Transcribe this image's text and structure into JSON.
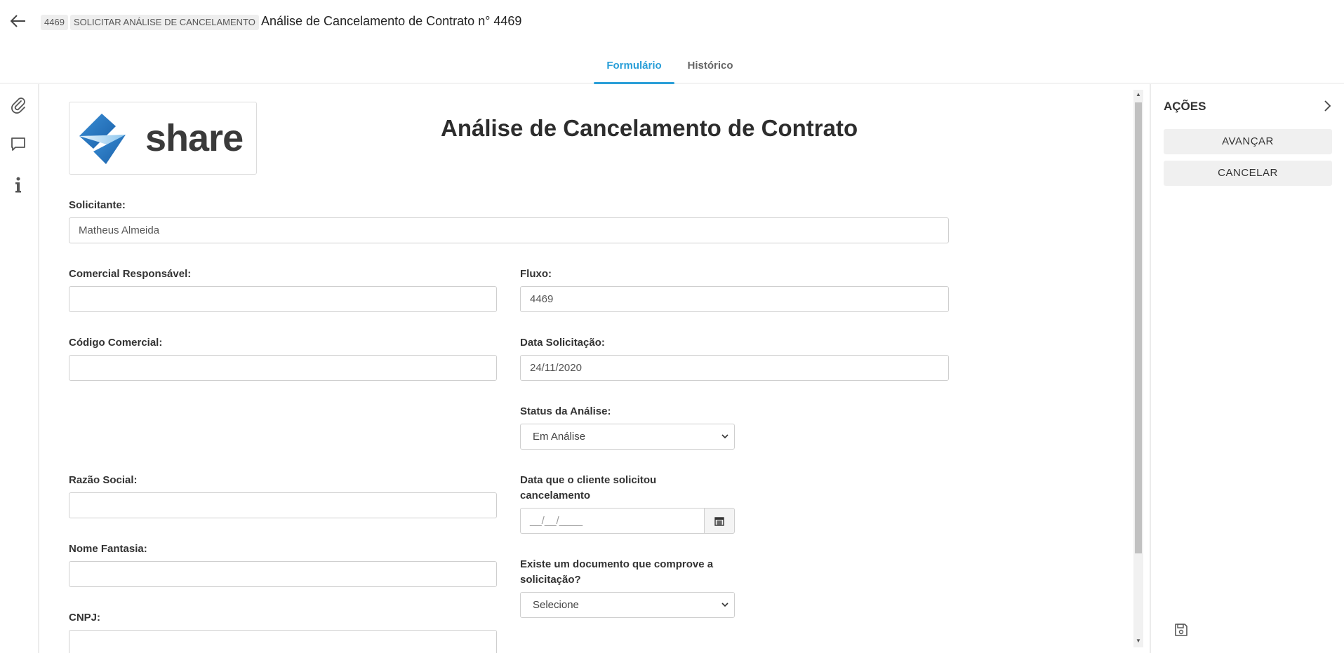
{
  "header": {
    "id_chip": "4469",
    "step_chip": "SOLICITAR ANÁLISE DE CANCELAMENTO",
    "title": "Análise de Cancelamento de Contrato n° 4469"
  },
  "tabs": [
    {
      "label": "Formulário",
      "active": true
    },
    {
      "label": "Histórico",
      "active": false
    }
  ],
  "rail": {
    "icons": [
      "paperclip-icon",
      "comment-icon",
      "info-icon"
    ]
  },
  "form": {
    "logo_text": "share",
    "heading": "Análise de Cancelamento de Contrato",
    "solicitante": {
      "label": "Solicitante:",
      "value": "Matheus Almeida"
    },
    "comercial_responsavel": {
      "label": "Comercial Responsável:",
      "value": ""
    },
    "fluxo": {
      "label": "Fluxo:",
      "value": "4469"
    },
    "codigo_comercial": {
      "label": "Código Comercial:",
      "value": ""
    },
    "data_solicitacao": {
      "label": "Data Solicitação:",
      "value": "24/11/2020"
    },
    "status_analise": {
      "label": "Status da Análise:",
      "value": "Em Análise"
    },
    "razao_social": {
      "label": "Razão Social:",
      "value": ""
    },
    "data_cliente": {
      "label_line1": "Data que o cliente solicitou",
      "label_line2": "cancelamento",
      "placeholder": "__/__/____"
    },
    "nome_fantasia": {
      "label": "Nome Fantasia:",
      "value": ""
    },
    "documento": {
      "label_line1": "Existe um documento que comprove a",
      "label_line2": "solicitação?",
      "value": "Selecione"
    },
    "cnpj": {
      "label": "CNPJ:",
      "value": ""
    }
  },
  "actions": {
    "title": "AÇÕES",
    "buttons": [
      "AVANÇAR",
      "CANCELAR"
    ]
  },
  "colors": {
    "accent": "#2a9fd8",
    "logo_blue_dark": "#1f6fb5",
    "logo_blue_light": "#5fb4ea"
  }
}
